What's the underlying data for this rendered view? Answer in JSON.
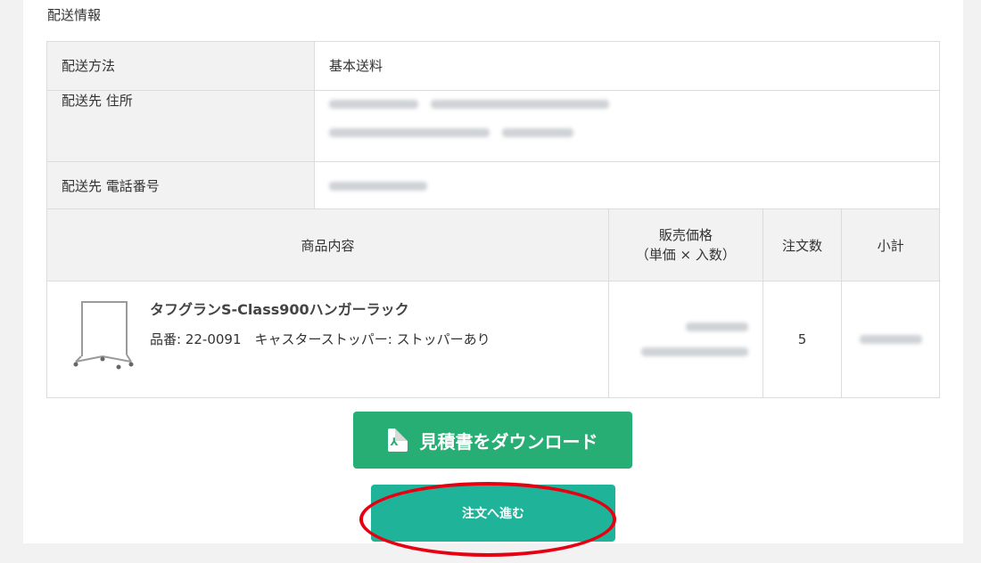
{
  "shipping": {
    "section_title": "配送情報",
    "method_label": "配送方法",
    "method_value": "基本送料",
    "address_label": "配送先 住所",
    "phone_label": "配送先 電話番号"
  },
  "items_table": {
    "headers": {
      "content": "商品内容",
      "price_line1": "販売価格",
      "price_line2": "（単価 × 入数）",
      "qty": "注文数",
      "subtotal": "小計"
    },
    "rows": [
      {
        "name": "タフグランS-Class900ハンガーラック",
        "meta": "品番: 22-0091　キャスターストッパー: ストッパーあり",
        "qty": "5"
      }
    ]
  },
  "buttons": {
    "estimate_label": "見積書をダウンロード",
    "order_label": "注文へ進む"
  },
  "colors": {
    "estimate_button": "#27ae74",
    "order_button": "#1fb49a",
    "highlight": "#e60012"
  },
  "icons": {
    "estimate": "pdf-file-icon"
  }
}
